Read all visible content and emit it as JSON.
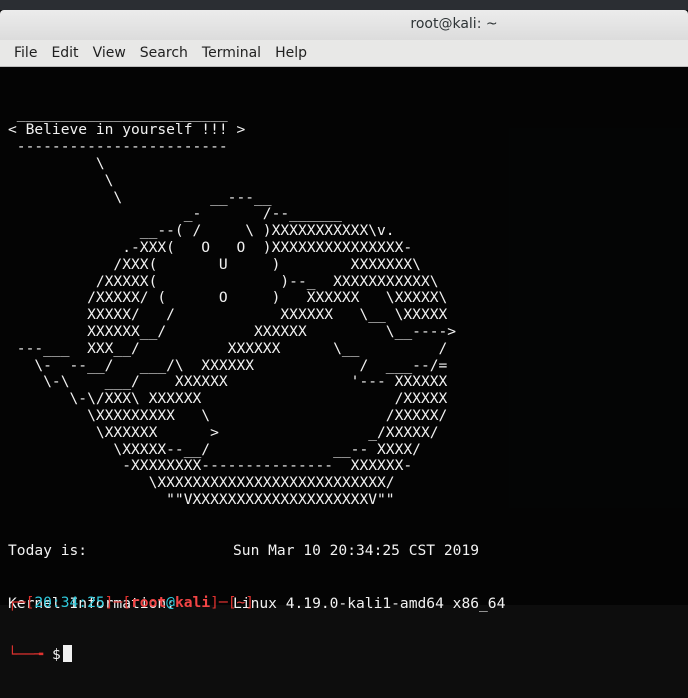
{
  "window": {
    "title": "root@kali: ~"
  },
  "menu": [
    "File",
    "Edit",
    "View",
    "Search",
    "Terminal",
    "Help"
  ],
  "cowsay": {
    "lines": [
      " ________________________",
      "< Believe in yourself !!! >",
      " ------------------------",
      "          \\",
      "           \\",
      "            \\          __---__",
      "                    _-       /--______",
      "               __--( /     \\ )XXXXXXXXXXX\\v.",
      "             .-XXX(   O   O  )XXXXXXXXXXXXXXX-",
      "            /XXX(       U     )        XXXXXXX\\",
      "          /XXXXX(              )--_  XXXXXXXXXXX\\",
      "         /XXXXX/ (      O     )   XXXXXX   \\XXXXX\\",
      "         XXXXX/   /            XXXXXX   \\__ \\XXXXX",
      "         XXXXXX__/          XXXXXX         \\__---->",
      " ---___  XXX__/          XXXXXX      \\__         /",
      "   \\-  --__/   ___/\\  XXXXXX            /  ___--/=",
      "    \\-\\    ___/    XXXXXX              '--- XXXXXX",
      "       \\-\\/XXX\\ XXXXXX                      /XXXXX",
      "         \\XXXXXXXXX   \\                    /XXXXX/",
      "          \\XXXXXX      >                 _/XXXXX/",
      "            \\XXXXX--__/              __-- XXXX/",
      "             -XXXXXXXX---------------  XXXXXX-",
      "                \\XXXXXXXXXXXXXXXXXXXXXXXXXX/",
      "                  \"\"VXXXXXXXXXXXXXXXXXXXXV\"\""
    ]
  },
  "info": {
    "today_label": "Today is:",
    "today_value": "Sun Mar 10 20:34:25 CST 2019",
    "kernel_label": "Kernel Information:",
    "kernel_value": "Linux 4.19.0-kali1-amd64 x86_64"
  },
  "prompt": {
    "time": "20:34:25",
    "user": "root",
    "at": "@",
    "host": "kali",
    "dir": "~",
    "symbol": "$"
  },
  "colors": {
    "prompt_frame": "#e0322f",
    "prompt_time": "#30c9dc",
    "prompt_user": "#f24545",
    "text": "#f2f2f2"
  }
}
